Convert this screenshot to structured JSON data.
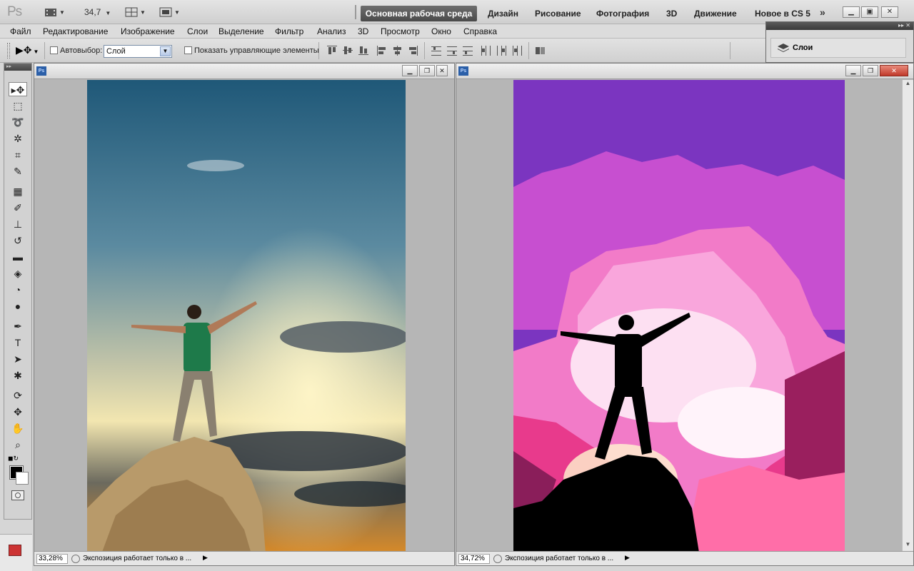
{
  "app": {
    "logo": "Ps",
    "zoom_display": "34,7",
    "workspaces": [
      "Основная рабочая среда",
      "Дизайн",
      "Рисование",
      "Фотография",
      "3D",
      "Движение",
      "Новое в CS 5"
    ],
    "more": "»"
  },
  "menu": [
    "Файл",
    "Редактирование",
    "Изображение",
    "Слои",
    "Выделение",
    "Фильтр",
    "Анализ",
    "3D",
    "Просмотр",
    "Окно",
    "Справка"
  ],
  "options": {
    "autoselect_label": "Автовыбор:",
    "autoselect_value": "Слой",
    "show_controls_label": "Показать управляющие элементы"
  },
  "layers_panel": {
    "title": "Слои"
  },
  "documents": [
    {
      "zoom": "33,28%",
      "status_text": "Экспозиция работает только в ..."
    },
    {
      "zoom": "34,72%",
      "status_text": "Экспозиция работает только в ..."
    }
  ],
  "colors": {
    "active_workspace_bg": "#555555",
    "doc_background": "#b6b6b6"
  }
}
